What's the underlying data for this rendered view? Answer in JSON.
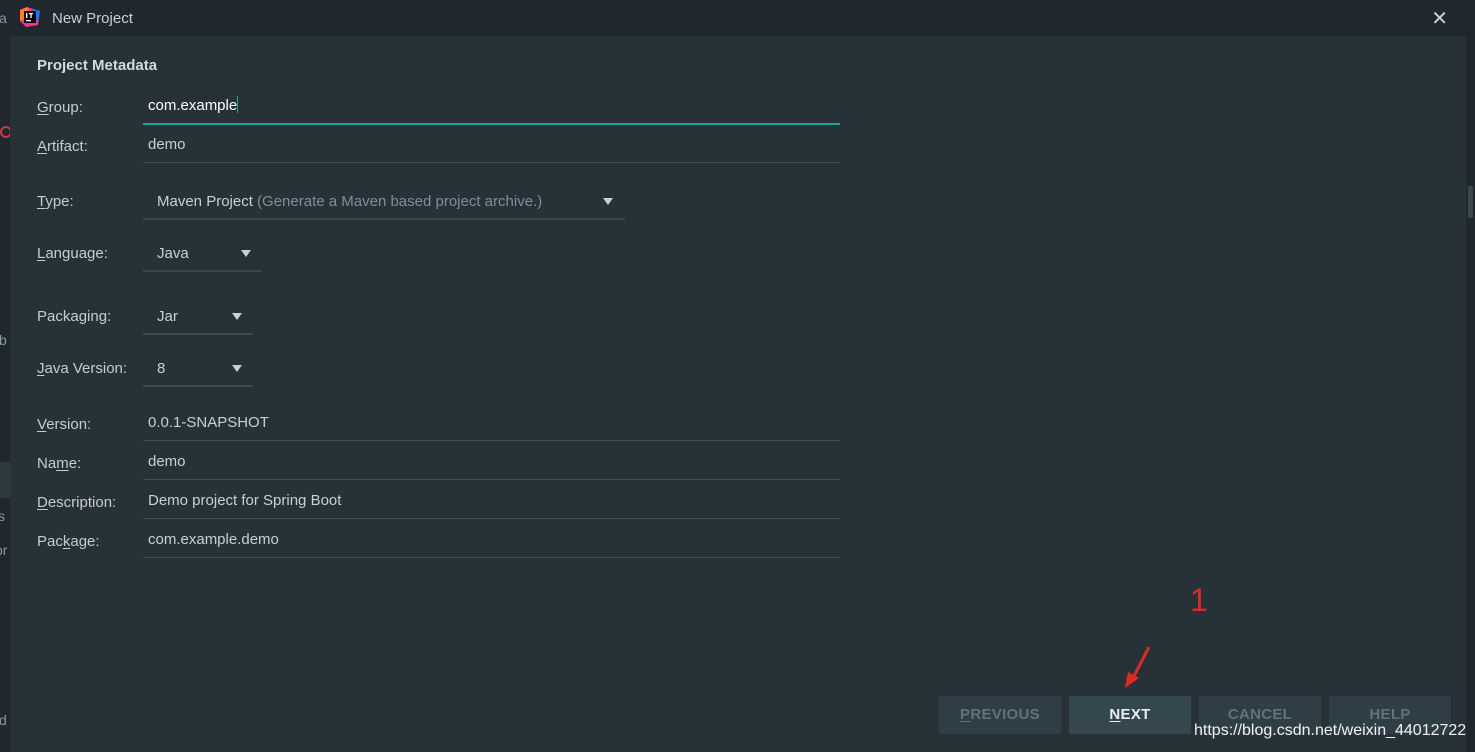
{
  "window": {
    "title": "New Project"
  },
  "background": {
    "frag1": "la",
    "frag2": "b",
    "frag3": "s",
    "frag4": "or",
    "frag5": "d"
  },
  "section_title": "Project Metadata",
  "fields": {
    "group": {
      "label_pre": "",
      "label_mnemonic": "G",
      "label_post": "roup:",
      "value": "com.example"
    },
    "artifact": {
      "label_pre": "",
      "label_mnemonic": "A",
      "label_post": "rtifact:",
      "value": "demo"
    },
    "type": {
      "label_pre": "",
      "label_mnemonic": "T",
      "label_post": "ype:",
      "value": "Maven Project",
      "hint": "(Generate a Maven based project archive.)"
    },
    "language": {
      "label_pre": "",
      "label_mnemonic": "L",
      "label_post": "anguage:",
      "value": "Java"
    },
    "packaging": {
      "label_pre": "Packaging:",
      "value": "Jar"
    },
    "java_version": {
      "label_pre": "",
      "label_mnemonic": "J",
      "label_post": "ava Version:",
      "value": "8"
    },
    "version": {
      "label_pre": "",
      "label_mnemonic": "V",
      "label_post": "ersion:",
      "value": "0.0.1-SNAPSHOT"
    },
    "name": {
      "label_pre": "Na",
      "label_mnemonic": "m",
      "label_post": "e:",
      "value": "demo"
    },
    "description": {
      "label_pre": "",
      "label_mnemonic": "D",
      "label_post": "escription:",
      "value": "Demo project for Spring Boot"
    },
    "package": {
      "label_pre": "Pac",
      "label_mnemonic": "k",
      "label_post": "age:",
      "value": "com.example.demo"
    }
  },
  "buttons": {
    "previous": {
      "mnemonic": "P",
      "rest": "REVIOUS"
    },
    "next": {
      "mnemonic": "N",
      "rest": "EXT"
    },
    "cancel": "CANCEL",
    "help": "HELP"
  },
  "annotation": {
    "number": "1",
    "color": "#e02a20"
  },
  "watermark": "https://blog.csdn.net/weixin_44012722",
  "colors": {
    "dialog_bg": "#263238",
    "accent": "#1fa394",
    "titlebar": "#1f282d"
  },
  "icons": {
    "app": "intellij-idea-icon",
    "close": "close-icon",
    "dropdown": "triangle-down-icon"
  }
}
